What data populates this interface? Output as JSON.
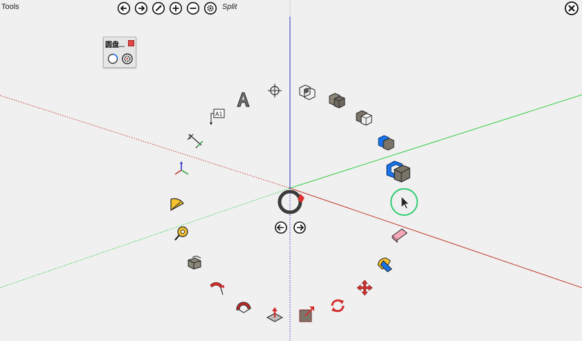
{
  "toolbar": {
    "title": "Tools",
    "mode": "Split",
    "buttons": [
      {
        "name": "back-button",
        "icon": "arrow-left-circle-icon"
      },
      {
        "name": "forward-button",
        "icon": "arrow-right-circle-icon"
      },
      {
        "name": "edit-button",
        "icon": "pencil-circle-icon"
      },
      {
        "name": "add-button",
        "icon": "plus-circle-icon"
      },
      {
        "name": "remove-button",
        "icon": "minus-circle-icon"
      },
      {
        "name": "settings-button",
        "icon": "gear-circle-icon"
      }
    ],
    "close_icon": "close-circle-icon"
  },
  "palette": {
    "title": "圆盘...",
    "tools": [
      "ring-outline-icon",
      "gear-icon"
    ]
  },
  "ring": {
    "tools": [
      "3d-text-icon",
      "tape-measure-guide-icon",
      "text-label-icon",
      "dimension-icon",
      "axes-icon",
      "protractor-icon",
      "tape-measure-icon",
      "push-pull-icon",
      "follow-me-icon",
      "paint-bucket-icon",
      "offset-icon",
      "scale-icon",
      "rotate-icon",
      "move-icon",
      "paint-icon",
      "eraser-icon",
      "select-icon",
      "group-icon",
      "component-icon",
      "component-outline-icon",
      "solid-box-icon",
      "wireframe-box-icon"
    ],
    "prev_icon": "arrow-left-circle-icon",
    "next_icon": "arrow-right-circle-icon"
  },
  "colors": {
    "background": "#f0f0f0",
    "red_axis": "#c0392b",
    "green_axis": "#2ecc40",
    "blue_axis": "#2c2cc8",
    "highlight_ring": "#2ecc71",
    "accent_blue": "#1a73e8"
  }
}
